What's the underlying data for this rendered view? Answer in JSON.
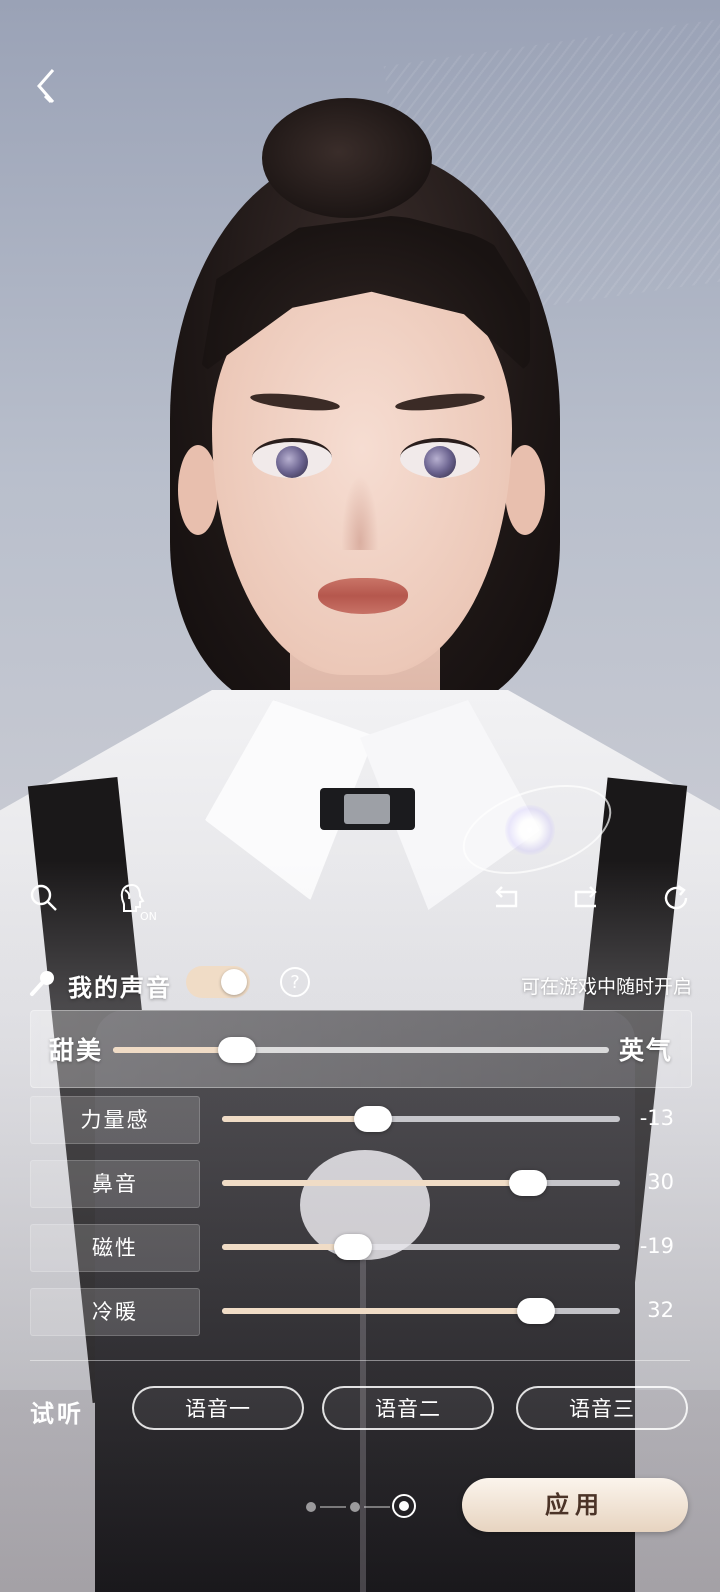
{
  "header": {
    "back_icon": "chevron-left-icon"
  },
  "toolbar": {
    "search_icon": "search-icon",
    "head_toggle_icon": "head-silhouette-icon",
    "head_toggle_badge": "ON",
    "undo_icon": "undo-icon",
    "redo_icon": "redo-icon",
    "reset_icon": "reset-icon"
  },
  "voice": {
    "mic_icon": "microphone-icon",
    "label": "我的声音",
    "toggle_on": true,
    "help_icon": "question-icon",
    "help_symbol": "?",
    "hint": "可在游戏中随时开启"
  },
  "main_slider": {
    "left_label": "甜美",
    "right_label": "英气",
    "fraction": 0.25
  },
  "params": [
    {
      "label": "力量感",
      "value": "-13",
      "fraction": 0.38
    },
    {
      "label": "鼻音",
      "value": "30",
      "fraction": 0.77
    },
    {
      "label": "磁性",
      "value": "-19",
      "fraction": 0.33
    },
    {
      "label": "冷暖",
      "value": "32",
      "fraction": 0.79
    }
  ],
  "listen": {
    "label": "试听",
    "buttons": [
      "语音一",
      "语音二",
      "语音三"
    ]
  },
  "pager": {
    "total": 3,
    "current": 3
  },
  "apply_label": "应用",
  "colors": {
    "accent": "#f0dcc6",
    "apply_text": "#4b3327"
  }
}
